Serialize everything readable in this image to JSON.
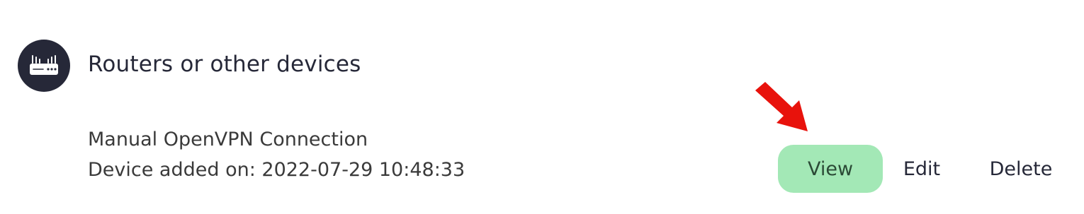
{
  "section": {
    "title": "Routers or other devices",
    "icon": "router-icon"
  },
  "device": {
    "name": "Manual OpenVPN Connection",
    "added_on": "Device added on: 2022-07-29 10:48:33"
  },
  "actions": {
    "view_label": "View",
    "edit_label": "Edit",
    "delete_label": "Delete"
  },
  "annotation": {
    "icon": "arrow-icon",
    "color": "#e8120c"
  },
  "colors": {
    "icon_background": "#262838",
    "view_button": "#a3e8b6"
  }
}
